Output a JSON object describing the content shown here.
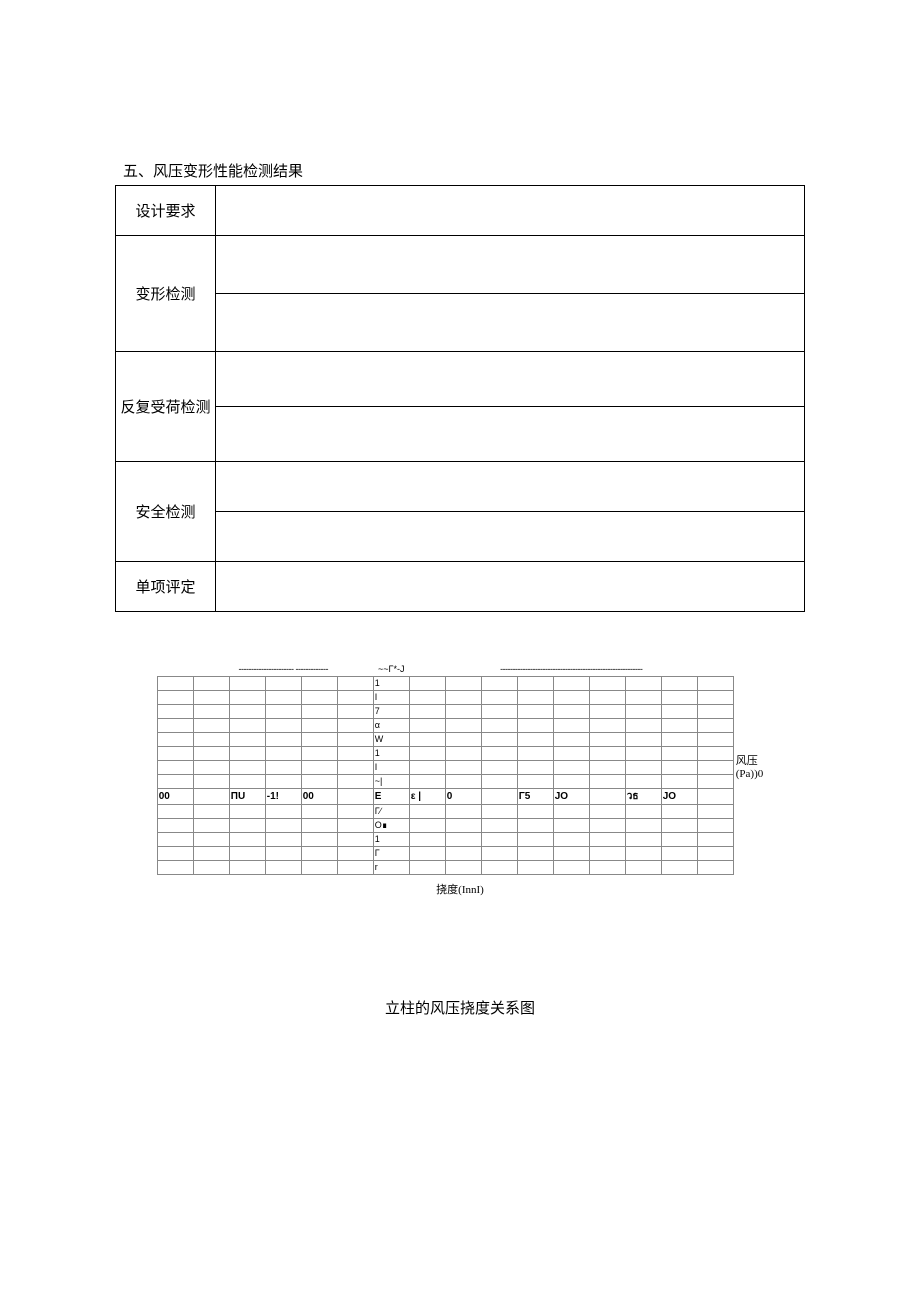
{
  "section_title": "五、风压变形性能检测结果",
  "table": {
    "rows": [
      {
        "label": "设计要求",
        "values": [
          ""
        ]
      },
      {
        "label": "变形检测",
        "values": [
          "",
          ""
        ]
      },
      {
        "label": "反复受荷检测",
        "values": [
          "",
          ""
        ]
      },
      {
        "label": "安全检测",
        "values": [
          "",
          ""
        ]
      },
      {
        "label": "单项评定",
        "values": [
          ""
        ]
      }
    ]
  },
  "chart_data": {
    "type": "line",
    "title": "立柱的风压挠度关系图",
    "xlabel": "挠度(InnI)",
    "ylabel_top": "风压",
    "ylabel_bottom": "(Pa))0",
    "top_marker": "~~Γ*-J",
    "x_axis_row": [
      "00",
      "",
      "ПU",
      "-1!",
      "00",
      "",
      "Ε",
      "ε |",
      "0",
      "",
      "Γ5",
      "JO",
      "",
      "วธ",
      "JO",
      ""
    ],
    "y_markers_top": [
      "1",
      "I",
      "7",
      "α",
      "W",
      "1",
      "I",
      "~|"
    ],
    "y_markers_bottom": [
      "Γ∕",
      "O∎",
      "1",
      "Γ",
      "r"
    ],
    "xlim": [
      -100,
      25
    ],
    "ylim": [
      -5,
      8
    ],
    "series": []
  },
  "chart_xlabel": "挠度(InnI)",
  "chart_y_top": "风压",
  "chart_y_bottom": "(Pa))0",
  "chart_title": "立柱的风压挠度关系图"
}
